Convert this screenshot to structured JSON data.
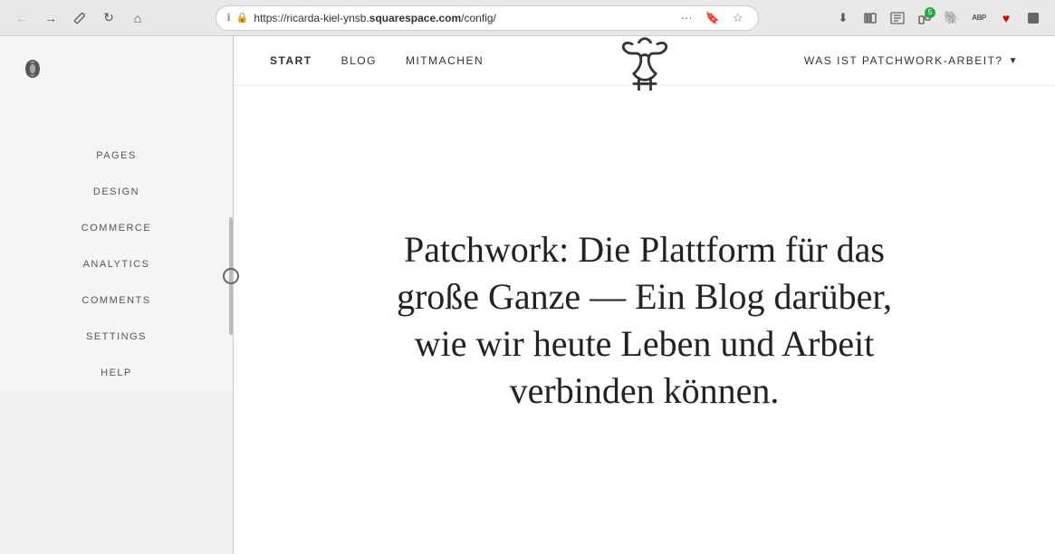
{
  "browser": {
    "url_prefix": "https://ricarda-kiel-ynsb.",
    "url_domain": "squarespace.com",
    "url_path": "/config/",
    "nav": {
      "back_label": "←",
      "forward_label": "→",
      "tools_label": "🔧",
      "reload_label": "↺",
      "home_label": "⌂"
    },
    "address_extras": [
      "···",
      "🔖",
      "⭐"
    ],
    "right_icons": {
      "download": "⬇",
      "library": "|||",
      "reader": "📖",
      "extensions_badge": "5",
      "elephant": "🐘",
      "abp": "ABP",
      "heart": "♥",
      "profile": "👤"
    }
  },
  "sidebar": {
    "logo_title": "Squarespace",
    "nav_items": [
      {
        "id": "pages",
        "label": "PAGES"
      },
      {
        "id": "design",
        "label": "DESIGN"
      },
      {
        "id": "commerce",
        "label": "COMMERCE"
      },
      {
        "id": "analytics",
        "label": "ANALYTICS"
      },
      {
        "id": "comments",
        "label": "COMMENTS"
      },
      {
        "id": "settings",
        "label": "SETTINGS"
      },
      {
        "id": "help",
        "label": "HELP"
      }
    ]
  },
  "site": {
    "nav_items": [
      {
        "id": "start",
        "label": "START",
        "active": true
      },
      {
        "id": "blog",
        "label": "BLOG"
      },
      {
        "id": "mitmachen",
        "label": "MITMACHEN"
      }
    ],
    "nav_right_label": "WAS IST PATCHWORK-ARBEIT?",
    "hero_text": "Patchwork: Die Plattform für das große Ganze — Ein Blog darüber, wie wir heute Leben und Arbeit verbinden können."
  }
}
